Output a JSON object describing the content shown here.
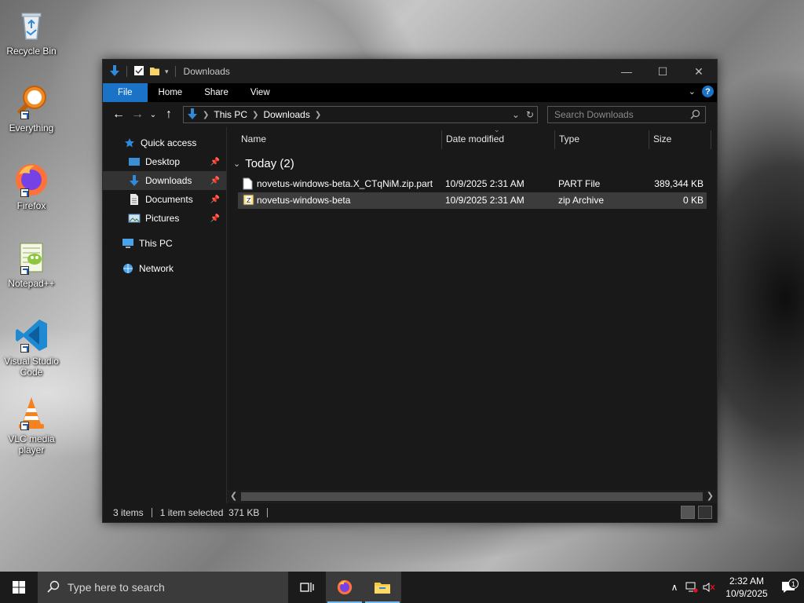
{
  "desktop": {
    "icons": [
      {
        "label": "Recycle Bin"
      },
      {
        "label": "Everything"
      },
      {
        "label": "Firefox"
      },
      {
        "label": "Notepad++"
      },
      {
        "label": "Visual Studio Code"
      },
      {
        "label": "VLC media player"
      }
    ]
  },
  "window": {
    "title": "Downloads",
    "ribbon_tabs": [
      "File",
      "Home",
      "Share",
      "View"
    ],
    "address": {
      "crumbs": [
        "This PC",
        "Downloads"
      ]
    },
    "search_placeholder": "Search Downloads",
    "nav_pane": {
      "quick_access": "Quick access",
      "items": [
        "Desktop",
        "Downloads",
        "Documents",
        "Pictures"
      ],
      "this_pc": "This PC",
      "network": "Network"
    },
    "columns": [
      "Name",
      "Date modified",
      "Type",
      "Size"
    ],
    "group_label": "Today (2)",
    "files": [
      {
        "name": "novetus-windows-beta.X_CTqNiM.zip.part",
        "date": "10/9/2025 2:31 AM",
        "type": "PART File",
        "size": "389,344 KB"
      },
      {
        "name": "novetus-windows-beta",
        "date": "10/9/2025 2:31 AM",
        "type": "zip Archive",
        "size": "0 KB"
      }
    ],
    "status": {
      "items": "3 items",
      "selection": "1 item selected  371 KB"
    }
  },
  "taskbar": {
    "search_placeholder": "Type here to search",
    "time": "2:32 AM",
    "date": "10/9/2025",
    "notification_count": "1"
  },
  "colors": {
    "accent": "#1a73c7",
    "window_bg": "#191919",
    "selection": "#3c3c3c"
  }
}
